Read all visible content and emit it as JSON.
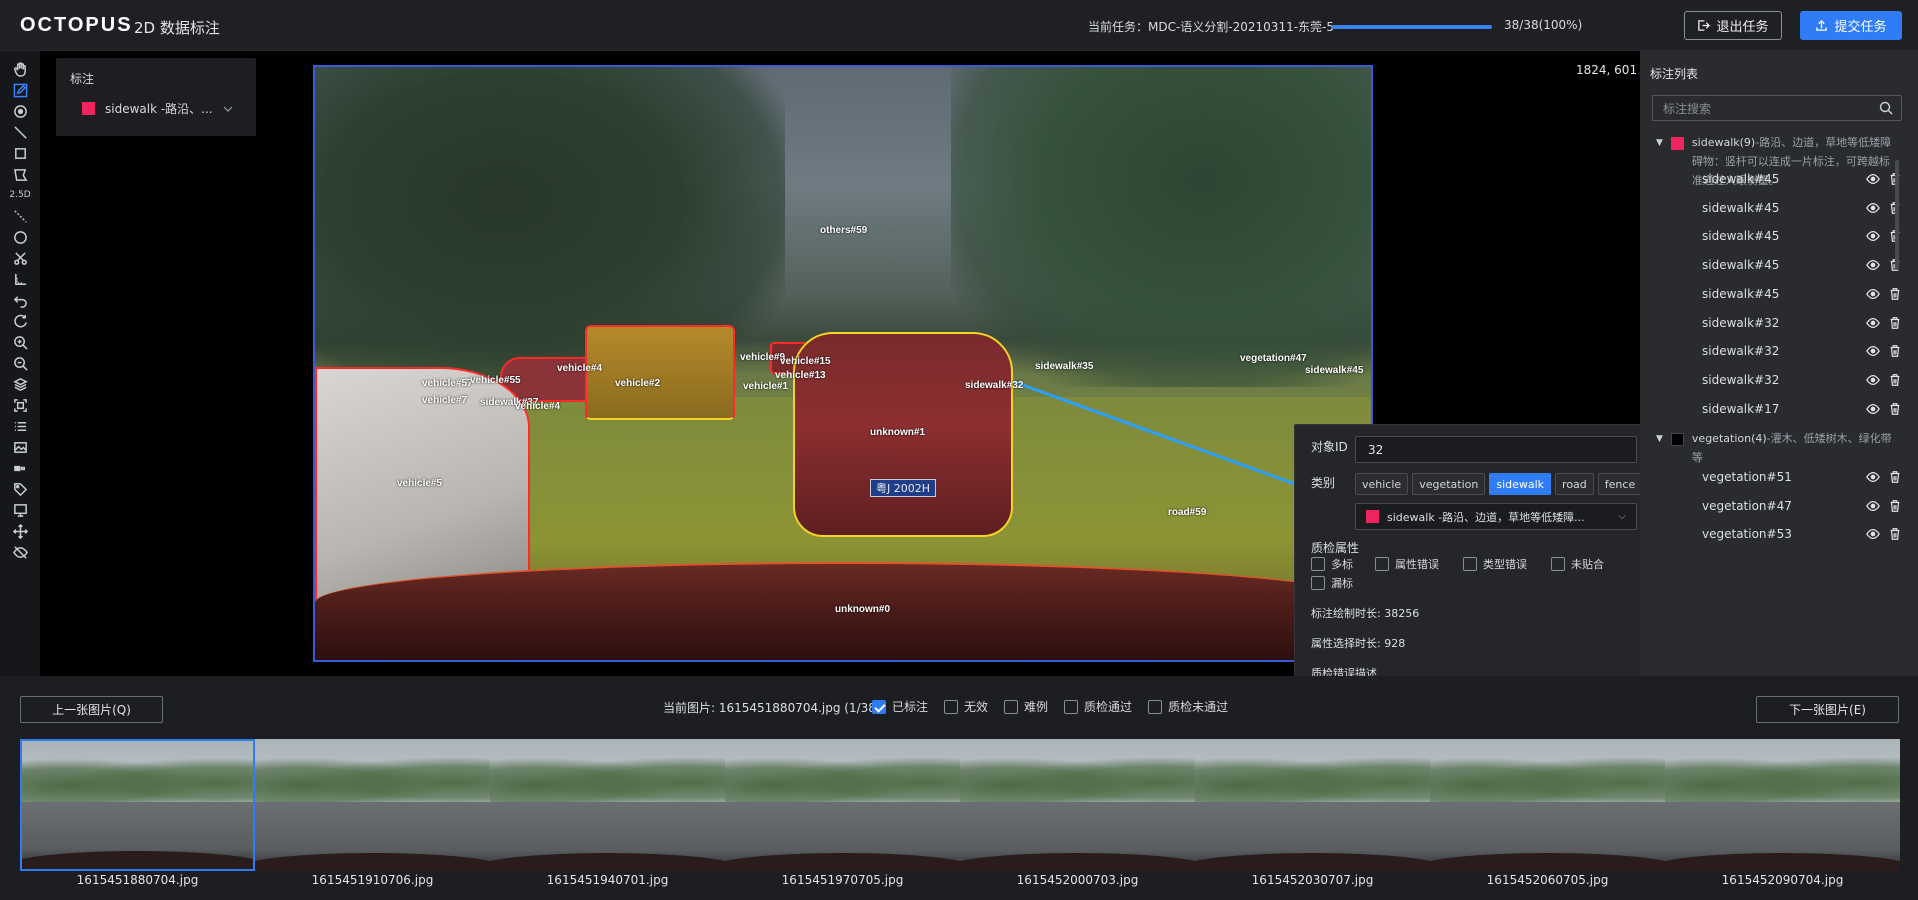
{
  "app": {
    "logo": "OCTOPUS",
    "title": "2D 数据标注",
    "task_label": "当前任务：MDC-语义分割-20210311-东莞-5",
    "progress_text": "38/38(100%)",
    "progress_fraction": 1.0,
    "exit_label": "退出任务",
    "submit_label": "提交任务"
  },
  "toolbar": {
    "mode_label": "2.5D"
  },
  "labels_panel": {
    "title": "标注",
    "selected_label": "sidewalk -路沿、...",
    "selected_color": "#f0245f"
  },
  "canvas": {
    "coordinates": "1824, 601",
    "plate_text": "粤J 2002H",
    "labels": [
      "others#59",
      "vehicle#57",
      "vehicle#55",
      "vehicle#4",
      "vehicle#7",
      "sidewalk#37",
      "vehicle#4",
      "vehicle#2",
      "vehicle#9",
      "vehicle#15",
      "vehicle#13",
      "vehicle#1",
      "sidewalk#32",
      "sidewalk#35",
      "unknown#1",
      "vehicle#5",
      "road#59",
      "unknown#0",
      "vegetation#47",
      "sidewalk#45"
    ]
  },
  "popup": {
    "object_id_label": "对象ID",
    "object_id_value": "32",
    "category_label": "类别",
    "categories": [
      "vehicle",
      "vegetation",
      "sidewalk",
      "road",
      "fence"
    ],
    "active_category": "sidewalk",
    "select_value": "sidewalk -路沿、边道，草地等低矮障...",
    "qa_label": "质检属性",
    "qa_options": [
      "多标",
      "属性错误",
      "类型错误",
      "未贴合",
      "漏标"
    ],
    "draw_time": "标注绘制时长: 38256",
    "attr_time": "属性选择时长: 928",
    "error_desc_label": "质检错误描述"
  },
  "rpanel": {
    "title": "标注列表",
    "search_placeholder": "标注搜索",
    "group1_title": "sidewalk(9)",
    "group1_desc": "-路沿、边道，草地等低矮障碍物：竖杆可以连成一片标注，可跨越标准通过人眼衡量。",
    "group1_items": [
      "sidewalk#45",
      "sidewalk#45",
      "sidewalk#45",
      "sidewalk#45",
      "sidewalk#45",
      "sidewalk#32",
      "sidewalk#32",
      "sidewalk#32",
      "sidewalk#17"
    ],
    "group2_title": "vegetation(4)",
    "group2_desc": "-灌木、低矮树木、绿化带等",
    "group2_items": [
      "vegetation#51",
      "vegetation#47",
      "vegetation#53"
    ]
  },
  "bottom": {
    "prev_label": "上一张图片(Q)",
    "next_label": "下一张图片(E)",
    "current_image": "当前图片: 1615451880704.jpg (1/38)",
    "status_options": [
      {
        "label": "已标注",
        "checked": true
      },
      {
        "label": "无效",
        "checked": false
      },
      {
        "label": "难例",
        "checked": false
      },
      {
        "label": "质检通过",
        "checked": false
      },
      {
        "label": "质检未通过",
        "checked": false
      }
    ],
    "thumbnails": [
      "1615451880704.jpg",
      "1615451910706.jpg",
      "1615451940701.jpg",
      "1615451970705.jpg",
      "1615452000703.jpg",
      "1615452030707.jpg",
      "1615452060705.jpg",
      "1615452090704.jpg"
    ]
  }
}
